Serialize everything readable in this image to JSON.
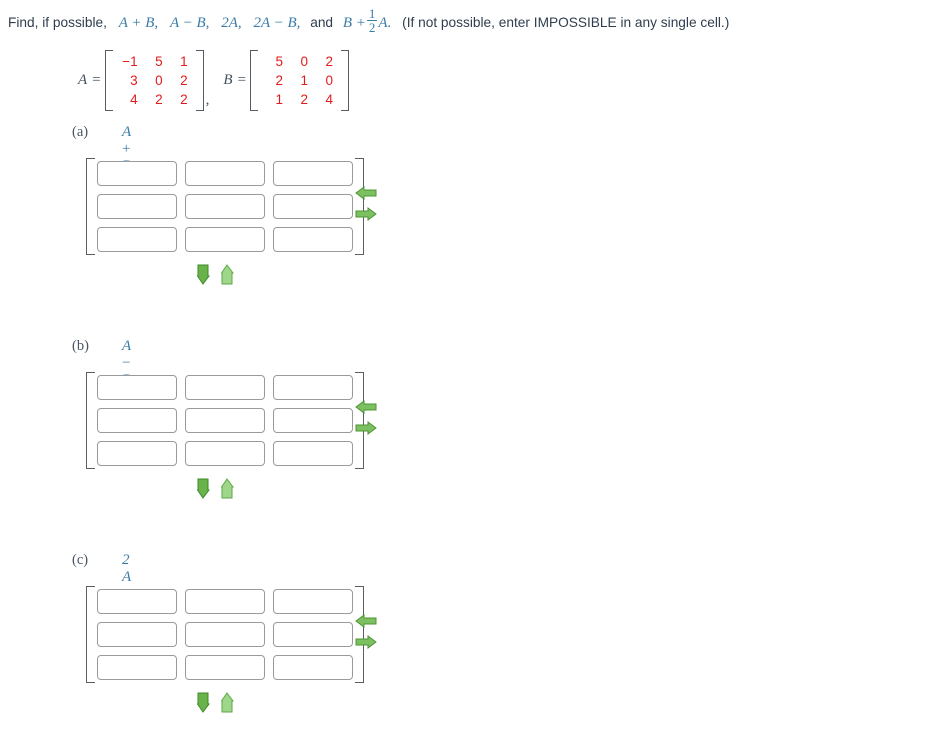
{
  "prompt": {
    "lead": "Find, if possible,",
    "terms": [
      "A + B,",
      "A − B,",
      "2A,",
      "2A − B,"
    ],
    "and_word": "and",
    "last_term_prefix": "B +",
    "fraction_numerator": "1",
    "fraction_denominator": "2",
    "last_term_suffix": "A.",
    "note": "(If not possible, enter IMPOSSIBLE in any single cell.)"
  },
  "given": {
    "matrix_a": {
      "label": "A",
      "equals": "=",
      "rows": [
        [
          "−1",
          "5",
          "1"
        ],
        [
          "3",
          "0",
          "2"
        ],
        [
          "4",
          "2",
          "2"
        ]
      ]
    },
    "separator": ",",
    "matrix_b": {
      "label": "B",
      "equals": "=",
      "rows": [
        [
          "5",
          "0",
          "2"
        ],
        [
          "2",
          "1",
          "0"
        ],
        [
          "1",
          "2",
          "4"
        ]
      ]
    }
  },
  "parts": [
    {
      "label": "(a)",
      "expression_left": "A",
      "expression_op": "+",
      "expression_right": "B",
      "answer_rows": [
        [
          "",
          "",
          ""
        ],
        [
          "",
          "",
          ""
        ],
        [
          "",
          "",
          ""
        ]
      ],
      "placeholder": ""
    },
    {
      "label": "(b)",
      "expression_left": "A",
      "expression_op": "−",
      "expression_right": "B",
      "answer_rows": [
        [
          "",
          "",
          ""
        ],
        [
          "",
          "",
          ""
        ],
        [
          "",
          "",
          ""
        ]
      ],
      "placeholder": ""
    },
    {
      "label": "(c)",
      "expression_left": "2",
      "expression_op": "",
      "expression_right": "A",
      "answer_rows": [
        [
          "",
          "",
          ""
        ],
        [
          "",
          "",
          ""
        ],
        [
          "",
          "",
          ""
        ]
      ],
      "placeholder": ""
    }
  ],
  "controls": {
    "remove_column_icon": "arrow-left-icon",
    "add_column_icon": "arrow-right-icon",
    "add_row_icon": "arrow-down-icon",
    "remove_row_icon": "arrow-up-icon"
  },
  "colors": {
    "matrix_value": "#e01b1b",
    "math_blue": "#3a7ca8",
    "arrow_green_dark": "#5aa33c",
    "arrow_green_light": "#8fcb78",
    "bracket_gray": "#5b5f63",
    "input_border": "#9a9a9a"
  }
}
